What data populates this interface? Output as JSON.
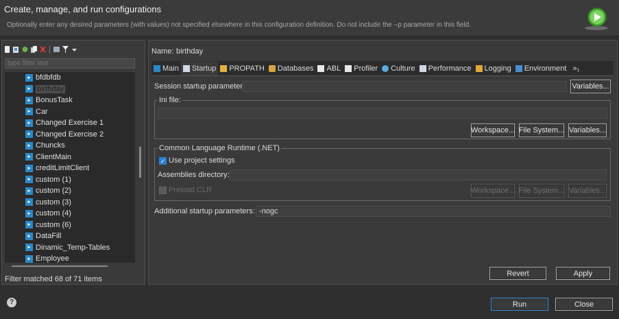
{
  "header": {
    "title": "Create, manage, and run configurations",
    "message": "Optionally enter any desired parameters (with values) not specified elsewhere in this configuration definition. Do not include the –p parameter in this field.",
    "icon": "run-configuration-icon"
  },
  "left_panel": {
    "toolbar_icons": [
      "new-config-icon",
      "new-prototype-icon",
      "export-icon",
      "duplicate-icon",
      "delete-icon",
      "collapse-all-icon",
      "filter-icon",
      "dropdown-icon"
    ],
    "filter_placeholder": "type filter text",
    "tree": [
      {
        "label": "bfdbfdb",
        "selected": false
      },
      {
        "label": "birthday",
        "selected": true
      },
      {
        "label": "BonusTask",
        "selected": false
      },
      {
        "label": "Car",
        "selected": false
      },
      {
        "label": "Changed Exercise 1",
        "selected": false
      },
      {
        "label": "Changed Exercise 2",
        "selected": false
      },
      {
        "label": "Chuncks",
        "selected": false
      },
      {
        "label": "ClientMain",
        "selected": false
      },
      {
        "label": "creditLimitClient",
        "selected": false
      },
      {
        "label": "custom (1)",
        "selected": false
      },
      {
        "label": "custom (2)",
        "selected": false
      },
      {
        "label": "custom (3)",
        "selected": false
      },
      {
        "label": "custom (4)",
        "selected": false
      },
      {
        "label": "custom (6)",
        "selected": false
      },
      {
        "label": "DataFill",
        "selected": false
      },
      {
        "label": "Dinamic_Temp-Tables",
        "selected": false
      },
      {
        "label": "Employee",
        "selected": false
      }
    ],
    "filter_status": "Filter matched 68 of 71 items"
  },
  "config": {
    "name_label": "Name:",
    "name_value": "birthday",
    "tabs": [
      {
        "label": "Main",
        "icon": "main-tab-icon"
      },
      {
        "label": "Startup",
        "icon": "startup-tab-icon",
        "active": true
      },
      {
        "label": "PROPATH",
        "icon": "propath-tab-icon"
      },
      {
        "label": "Databases",
        "icon": "databases-tab-icon"
      },
      {
        "label": "ABL",
        "icon": "abl-tab-icon"
      },
      {
        "label": "Profiler",
        "icon": "profiler-tab-icon"
      },
      {
        "label": "Culture",
        "icon": "culture-tab-icon"
      },
      {
        "label": "Performance",
        "icon": "performance-tab-icon"
      },
      {
        "label": "Logging",
        "icon": "logging-tab-icon"
      },
      {
        "label": "Environment",
        "icon": "environment-tab-icon"
      }
    ],
    "tabs_overflow": "»₁",
    "session_label": "Session startup parameter:",
    "session_value": "",
    "variables_label": "Variables...",
    "ini_group_title": "Ini file:",
    "ini_value": "",
    "workspace_label": "Workspace...",
    "filesystem_label": "File System...",
    "clr_group_title": "Common Language Runtime (.NET)",
    "use_project_settings_label": "Use project settings",
    "use_project_settings_checked": true,
    "assemblies_label": "Assemblies directory:",
    "assemblies_value": "",
    "preload_clr_label": "Preload CLR",
    "preload_clr_checked": false,
    "additional_label": "Additional startup parameters:",
    "additional_value": "-nogc",
    "revert_label": "Revert",
    "apply_label": "Apply"
  },
  "footer": {
    "help_icon": "help-icon",
    "run_label": "Run",
    "close_label": "Close"
  },
  "colors": {
    "background": "#2f2f2f",
    "panel": "#3a3a3a",
    "tree_icon": "#2c89c5",
    "accent": "#3c8fd8"
  }
}
